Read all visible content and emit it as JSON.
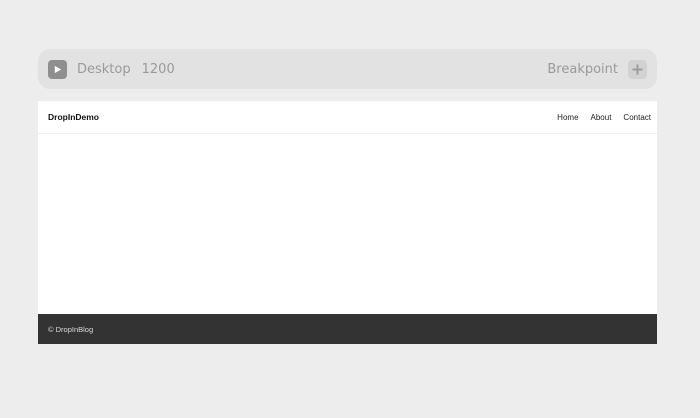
{
  "toolbar": {
    "play_icon": "play-icon",
    "device_label": "Desktop",
    "width_value": "1200",
    "breakpoint_label": "Breakpoint",
    "add_icon": "plus-icon"
  },
  "site": {
    "brand": "DropInDemo",
    "nav": [
      {
        "label": "Home"
      },
      {
        "label": "About"
      },
      {
        "label": "Contact"
      }
    ],
    "footer_text": "© DropInBlog"
  },
  "colors": {
    "page_background": "#ededed",
    "toolbar_background": "#e2e2e2",
    "footer_background": "#333333"
  }
}
